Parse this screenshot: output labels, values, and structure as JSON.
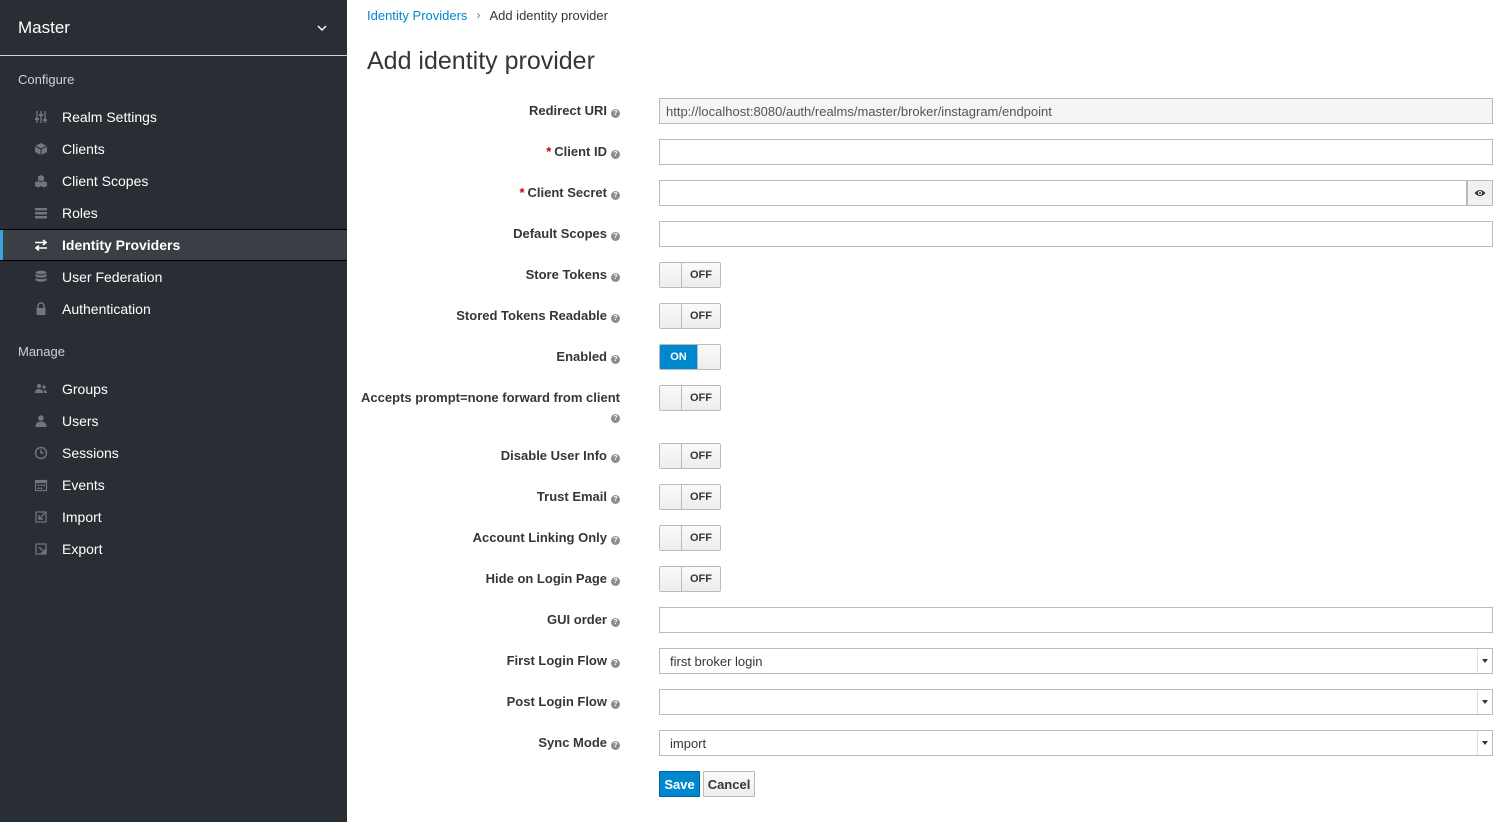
{
  "sidebar": {
    "realm": "Master",
    "configure_title": "Configure",
    "configure_items": [
      {
        "label": "Realm Settings",
        "icon": "sliders-icon"
      },
      {
        "label": "Clients",
        "icon": "cube-icon"
      },
      {
        "label": "Client Scopes",
        "icon": "cubes-icon"
      },
      {
        "label": "Roles",
        "icon": "list-icon"
      },
      {
        "label": "Identity Providers",
        "icon": "exchange-icon",
        "active": true
      },
      {
        "label": "User Federation",
        "icon": "database-icon"
      },
      {
        "label": "Authentication",
        "icon": "lock-icon"
      }
    ],
    "manage_title": "Manage",
    "manage_items": [
      {
        "label": "Groups",
        "icon": "users-group-icon"
      },
      {
        "label": "Users",
        "icon": "user-icon"
      },
      {
        "label": "Sessions",
        "icon": "clock-icon"
      },
      {
        "label": "Events",
        "icon": "calendar-icon"
      },
      {
        "label": "Import",
        "icon": "import-icon"
      },
      {
        "label": "Export",
        "icon": "export-icon"
      }
    ]
  },
  "breadcrumb": {
    "parent": "Identity Providers",
    "separator": "›",
    "current": "Add identity provider"
  },
  "page": {
    "title": "Add identity provider"
  },
  "form": {
    "redirect_uri": {
      "label": "Redirect URI",
      "value": "http://localhost:8080/auth/realms/master/broker/instagram/endpoint"
    },
    "client_id": {
      "label": "Client ID",
      "required_mark": "*",
      "value": ""
    },
    "client_secret": {
      "label": "Client Secret",
      "required_mark": "*",
      "value": ""
    },
    "default_scopes": {
      "label": "Default Scopes",
      "value": ""
    },
    "store_tokens": {
      "label": "Store Tokens",
      "state": "OFF"
    },
    "stored_tokens_readable": {
      "label": "Stored Tokens Readable",
      "state": "OFF"
    },
    "enabled": {
      "label": "Enabled",
      "state": "ON"
    },
    "accepts_prompt": {
      "label": "Accepts prompt=none forward from client",
      "state": "OFF"
    },
    "disable_user_info": {
      "label": "Disable User Info",
      "state": "OFF"
    },
    "trust_email": {
      "label": "Trust Email",
      "state": "OFF"
    },
    "account_linking_only": {
      "label": "Account Linking Only",
      "state": "OFF"
    },
    "hide_on_login_page": {
      "label": "Hide on Login Page",
      "state": "OFF"
    },
    "gui_order": {
      "label": "GUI order",
      "value": ""
    },
    "first_login_flow": {
      "label": "First Login Flow",
      "value": "first broker login"
    },
    "post_login_flow": {
      "label": "Post Login Flow",
      "value": ""
    },
    "sync_mode": {
      "label": "Sync Mode",
      "value": "import"
    },
    "help_glyph": "?"
  },
  "buttons": {
    "save": "Save",
    "cancel": "Cancel"
  },
  "colors": {
    "sidebar_bg": "#292e34",
    "accent": "#0088ce",
    "active_indicator": "#39a5dc",
    "required": "#cc0000"
  }
}
